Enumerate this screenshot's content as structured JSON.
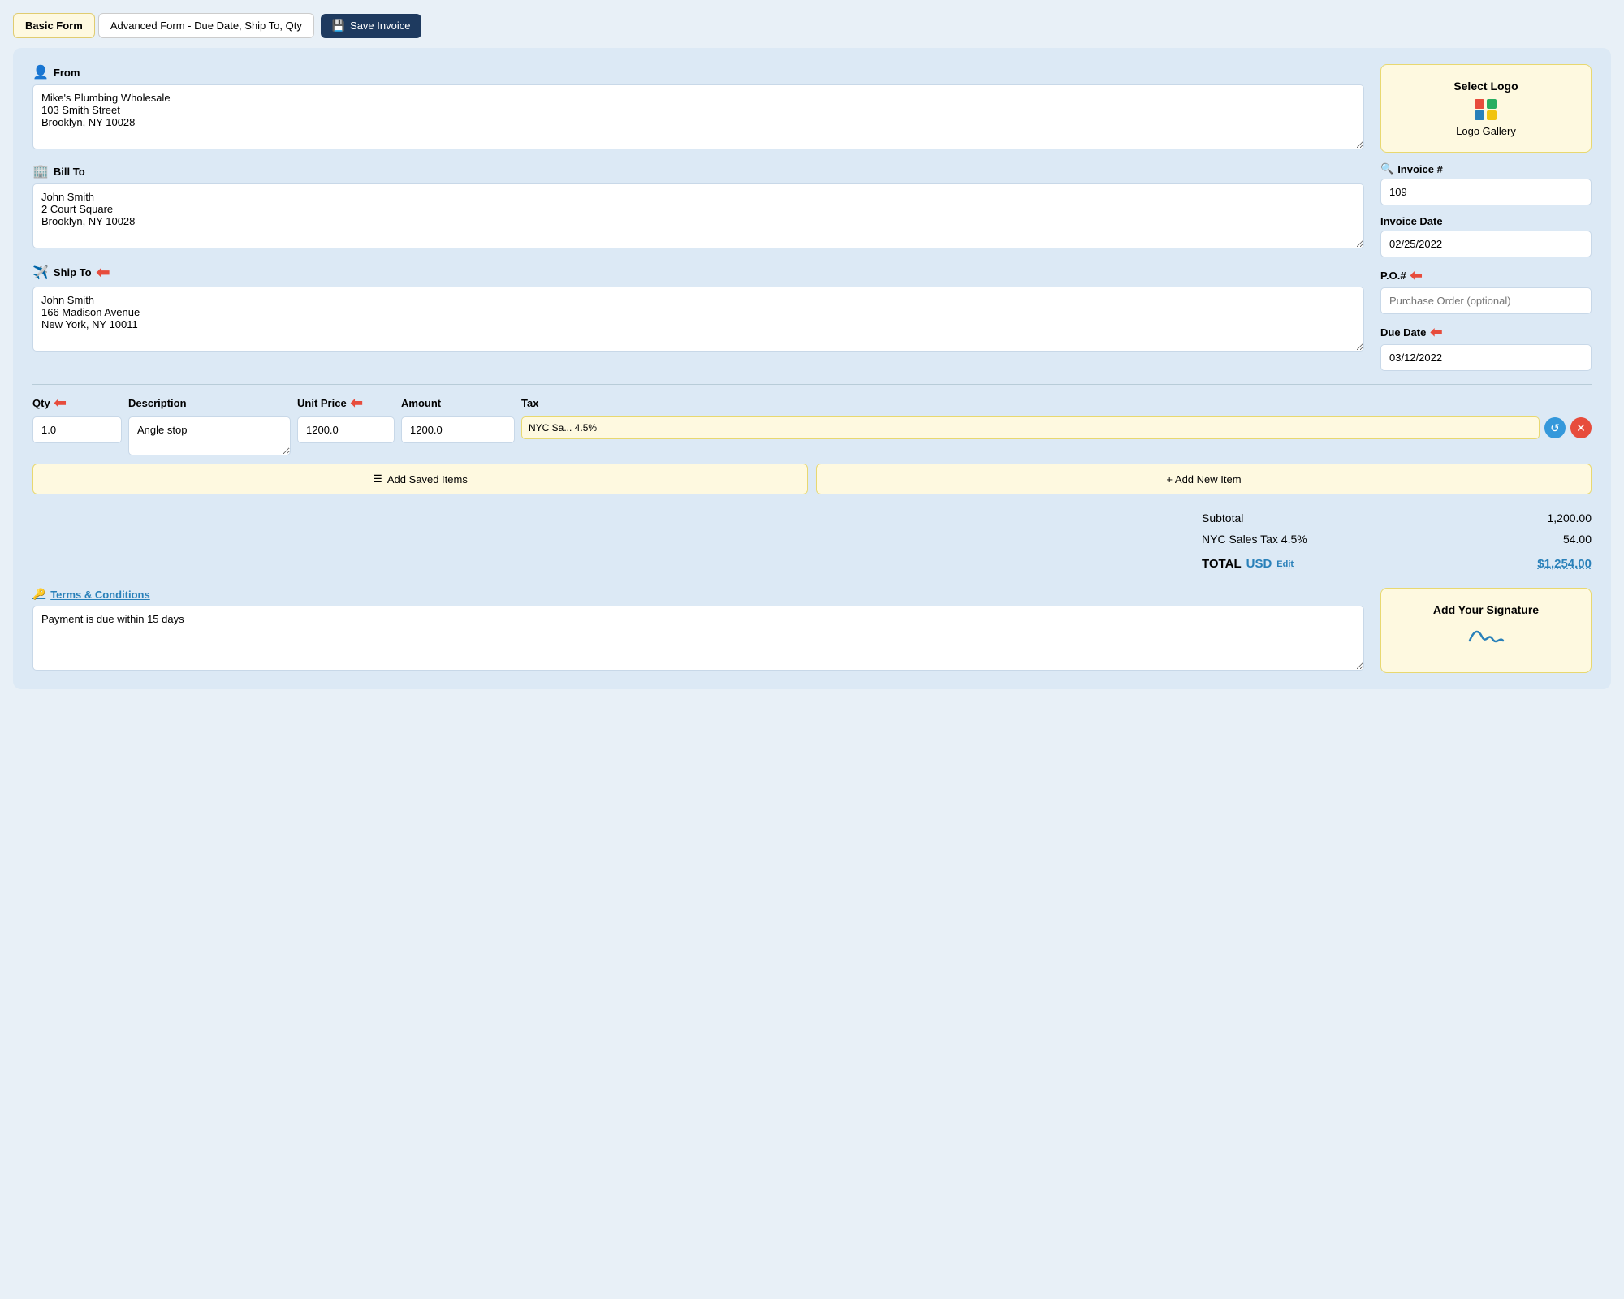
{
  "tabs": [
    {
      "id": "basic",
      "label": "Basic Form",
      "active": true
    },
    {
      "id": "advanced",
      "label": "Advanced Form - Due Date, Ship To, Qty",
      "active": false
    },
    {
      "id": "save",
      "label": "Save Invoice",
      "active": false
    }
  ],
  "from": {
    "label": "From",
    "icon": "👤",
    "value": "Mike's Plumbing Wholesale\n103 Smith Street\nBrooklyn, NY 10028"
  },
  "bill_to": {
    "label": "Bill To",
    "icon": "🏢",
    "value": "John Smith\n2 Court Square\nBrooklyn, NY 10028"
  },
  "ship_to": {
    "label": "Ship To",
    "icon": "✈️",
    "value": "John Smith\n166 Madison Avenue\nNew York, NY 10011"
  },
  "logo": {
    "select_label": "Select Logo",
    "gallery_label": "Logo Gallery"
  },
  "invoice_number": {
    "label": "Invoice #",
    "icon": "🔍",
    "value": "109"
  },
  "invoice_date": {
    "label": "Invoice Date",
    "value": "02/25/2022"
  },
  "po_number": {
    "label": "P.O.#",
    "placeholder": "Purchase Order (optional)"
  },
  "due_date": {
    "label": "Due Date",
    "value": "03/12/2022"
  },
  "items_header": {
    "qty": "Qty",
    "description": "Description",
    "unit_price": "Unit Price",
    "amount": "Amount",
    "tax": "Tax"
  },
  "items": [
    {
      "qty": "1.0",
      "description": "Angle stop",
      "unit_price": "1200.0",
      "amount": "1200.0",
      "tax": "NYC Sa... 4.5%"
    }
  ],
  "add_saved_items_label": "Add Saved Items",
  "add_new_item_label": "+ Add New Item",
  "totals": {
    "subtotal_label": "Subtotal",
    "subtotal_value": "1,200.00",
    "tax_label": "NYC Sales Tax 4.5%",
    "tax_value": "54.00",
    "total_label": "TOTAL",
    "total_currency": "USD",
    "total_edit": "Edit",
    "total_value": "$1,254.00"
  },
  "terms": {
    "label": "Terms & Conditions",
    "icon": "🔑",
    "value": "Payment is due within 15 days"
  },
  "signature": {
    "label": "Add Your Signature",
    "icon": "✍"
  },
  "colors": {
    "accent_blue": "#1e3a5f",
    "tab_yellow_bg": "#fef9e0",
    "arrow_red": "#e74c3c"
  }
}
